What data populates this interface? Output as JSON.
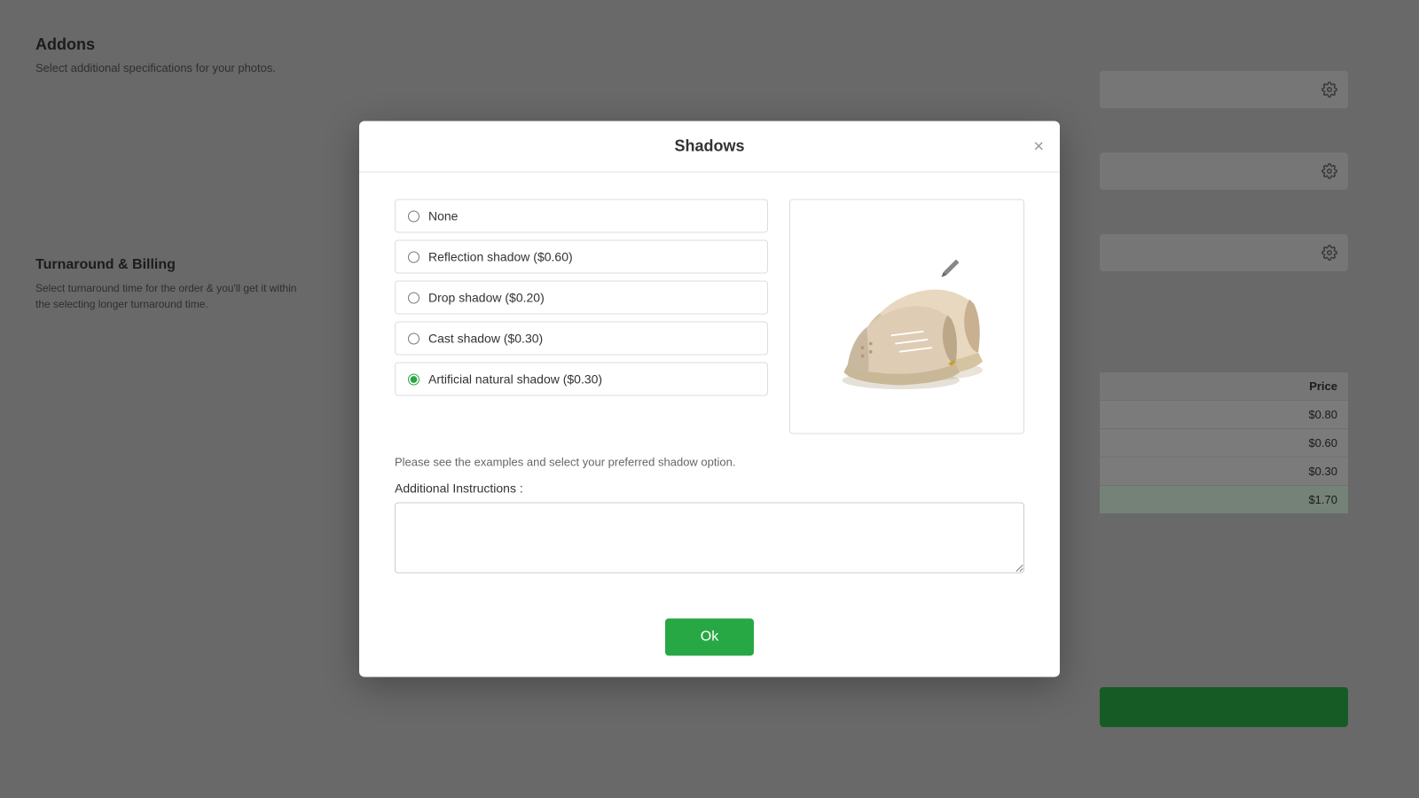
{
  "background": {
    "addons_title": "Addons",
    "addons_subtitle": "Select additional specifications for your photos.",
    "turnaround_title": "Turnaround & Billing",
    "turnaround_text": "Select turnaround time for the order & you'll get it within the selecting longer turnaround time.",
    "price_column": "Price",
    "price_rows": [
      "$0.80",
      "$0.60",
      "$0.30",
      "$1.70"
    ]
  },
  "modal": {
    "title": "Shadows",
    "close_label": "×",
    "options": [
      {
        "id": "none",
        "label": "None",
        "checked": false
      },
      {
        "id": "reflection",
        "label": "Reflection shadow ($0.60)",
        "checked": false
      },
      {
        "id": "drop",
        "label": "Drop shadow ($0.20)",
        "checked": false
      },
      {
        "id": "cast",
        "label": "Cast shadow ($0.30)",
        "checked": false
      },
      {
        "id": "artificial",
        "label": "Artificial natural shadow ($0.30)",
        "checked": true
      }
    ],
    "hint_text": "Please see the examples and select your preferred shadow option.",
    "instructions_label": "Additional Instructions :",
    "instructions_placeholder": "",
    "ok_label": "Ok"
  }
}
